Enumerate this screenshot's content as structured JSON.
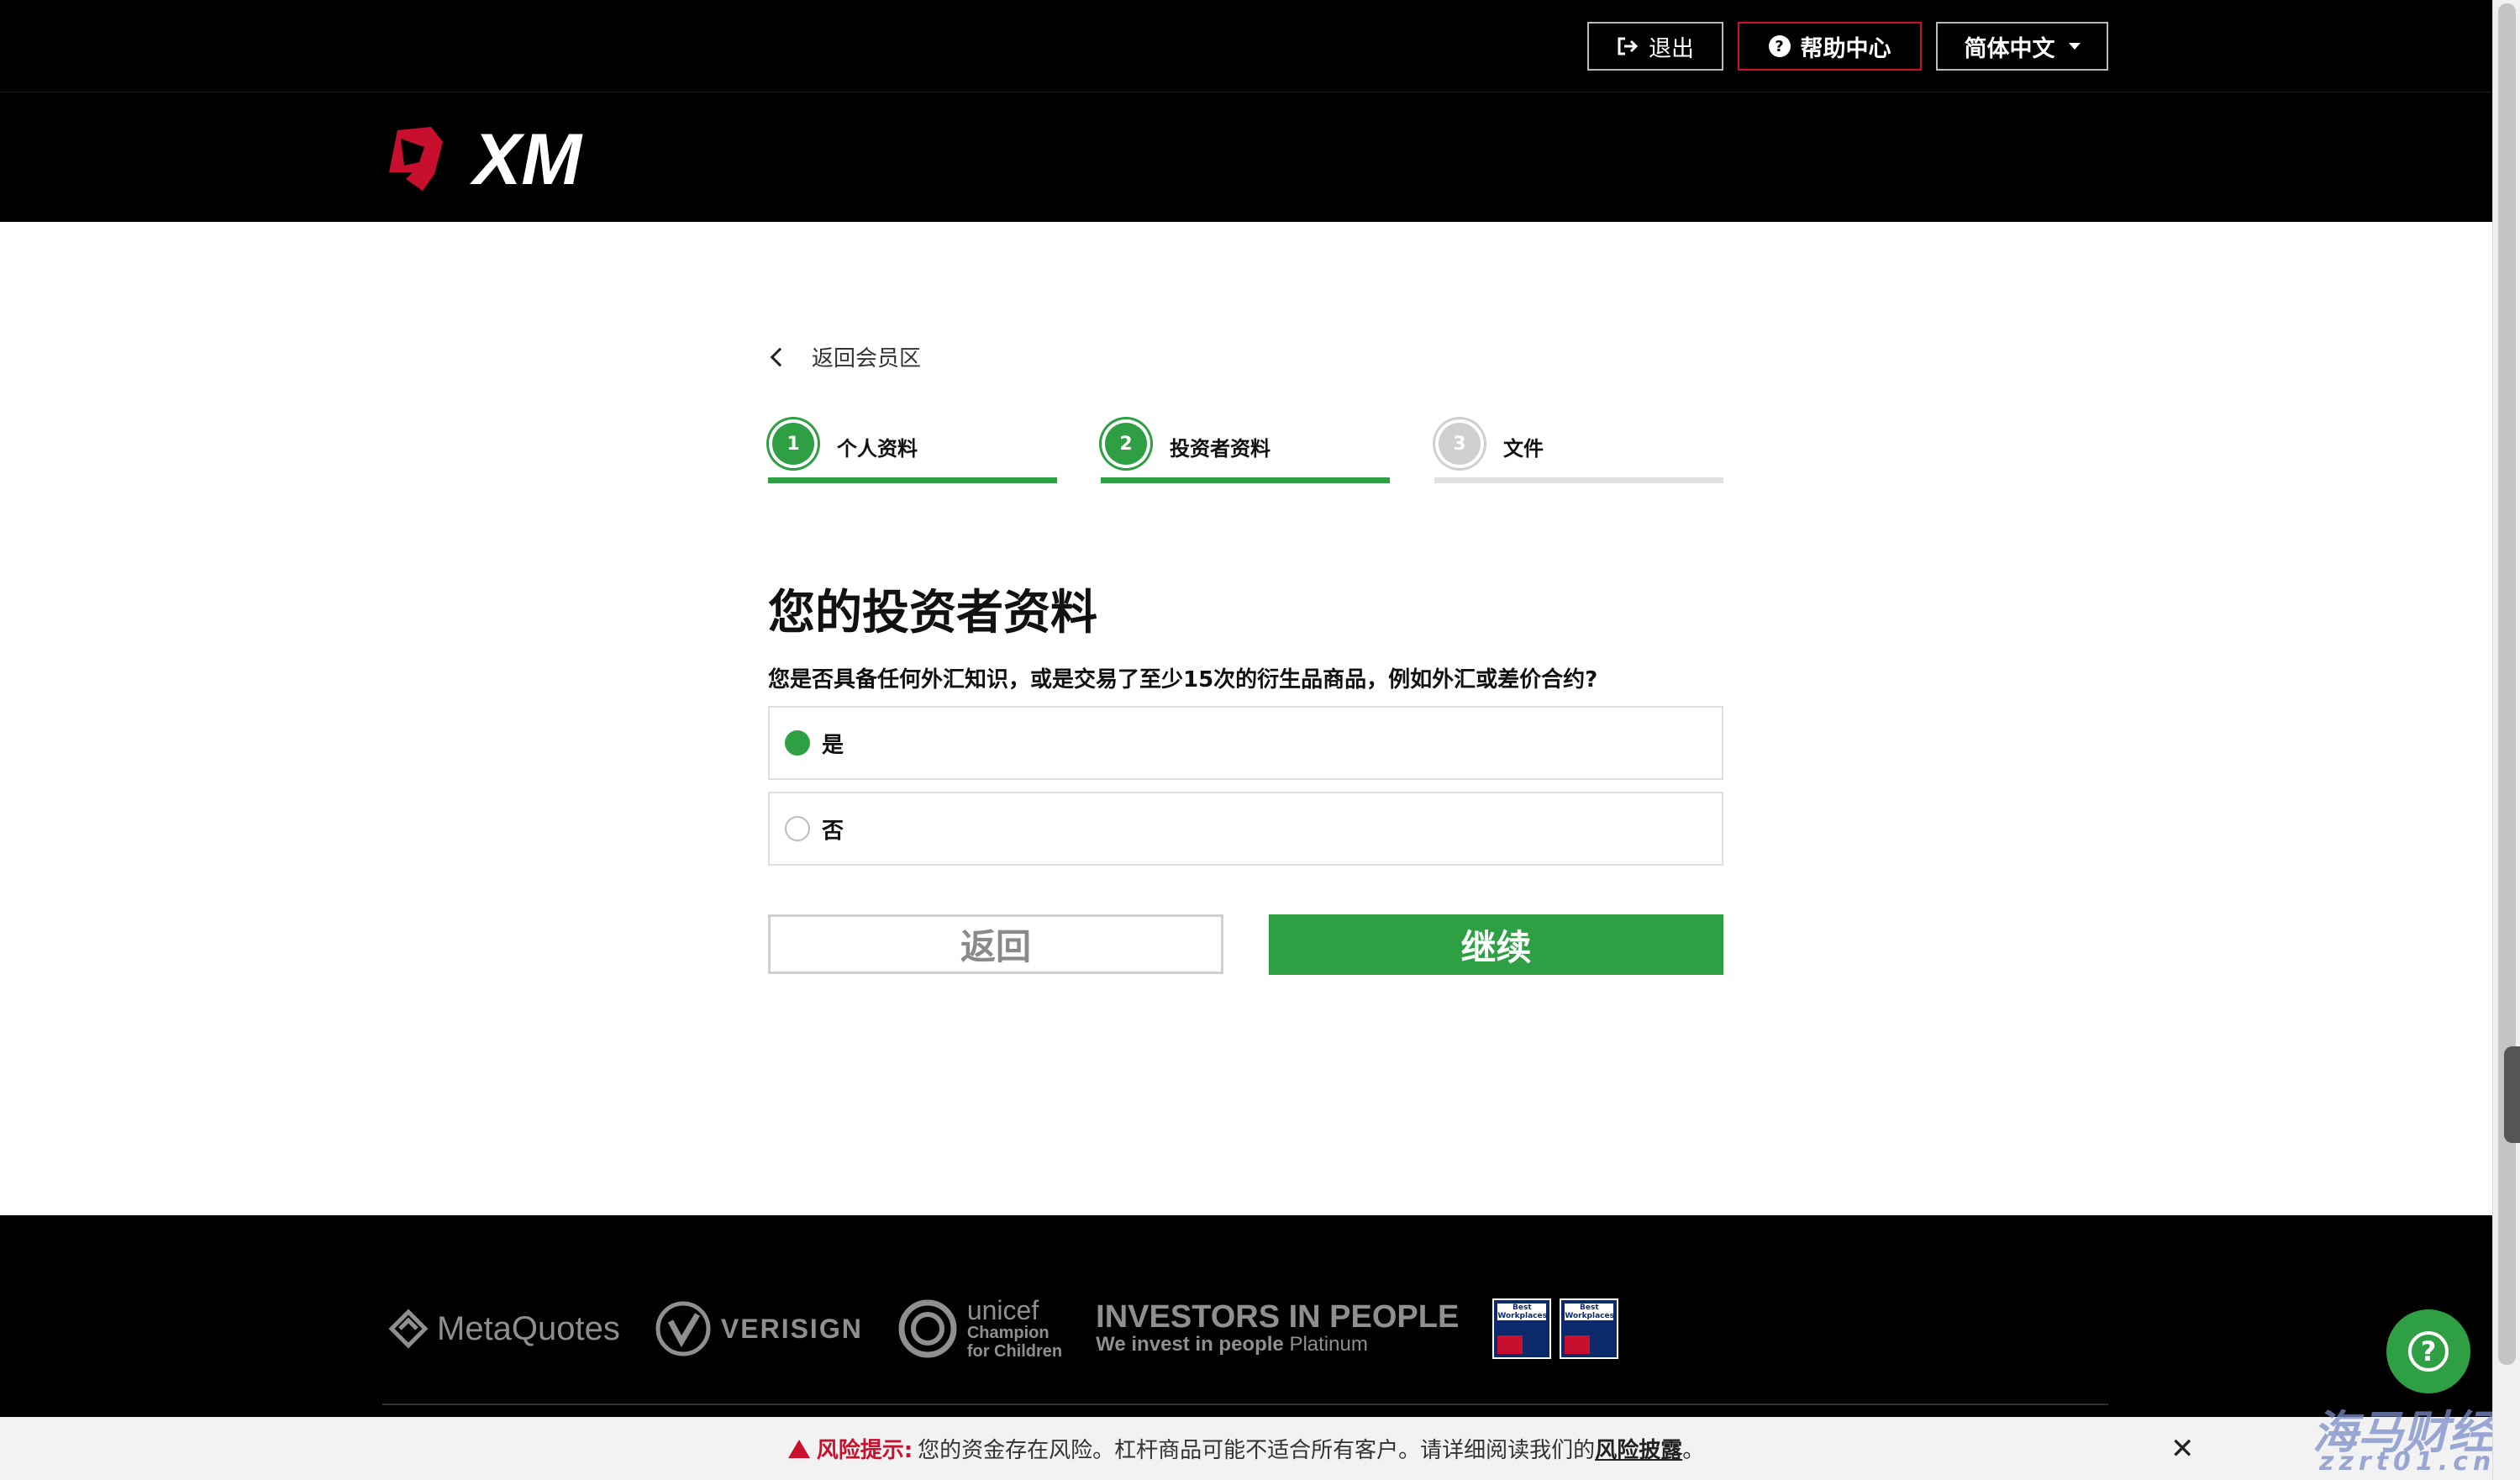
{
  "topbar": {
    "logout_label": "退出",
    "help_label": "帮助中心",
    "help_icon_glyph": "?",
    "language_label": "简体中文"
  },
  "header": {
    "logo_text": "XM"
  },
  "nav": {
    "back_link_label": "返回会员区"
  },
  "steps": [
    {
      "number": "1",
      "label": "个人资料",
      "state": "completed"
    },
    {
      "number": "2",
      "label": "投资者资料",
      "state": "active"
    },
    {
      "number": "3",
      "label": "文件",
      "state": "pending"
    }
  ],
  "form": {
    "title": "您的投资者资料",
    "question": "您是否具备任何外汇知识，或是交易了至少15次的衍生品商品，例如外汇或差价合约?",
    "options": [
      {
        "label": "是",
        "selected": true
      },
      {
        "label": "否",
        "selected": false
      }
    ],
    "back_button": "返回",
    "continue_button": "继续"
  },
  "footer": {
    "partners": {
      "metaquotes": "MetaQuotes",
      "verisign": "VERISIGN",
      "unicef_name": "unicef",
      "unicef_line1": "Champion",
      "unicef_line2": "for Children",
      "iip_line1": "INVESTORS IN PEOPLE",
      "iip_line2": "We invest in people",
      "iip_level": "Platinum",
      "badge_text": "Best Workplaces"
    },
    "help_fab_glyph": "?"
  },
  "risk_bar": {
    "label": "风险提示:",
    "text": "您的资金存在风险。杠杆商品可能不适合所有客户。请详细阅读我们的",
    "link": "风险披露",
    "end": "。",
    "close_glyph": "✕"
  },
  "watermark": {
    "line1": "海马财经",
    "line2": "zzrt01.cn"
  },
  "colors": {
    "accent_green": "#2ea043",
    "brand_red": "#c8102e",
    "background_dark": "#000000"
  }
}
